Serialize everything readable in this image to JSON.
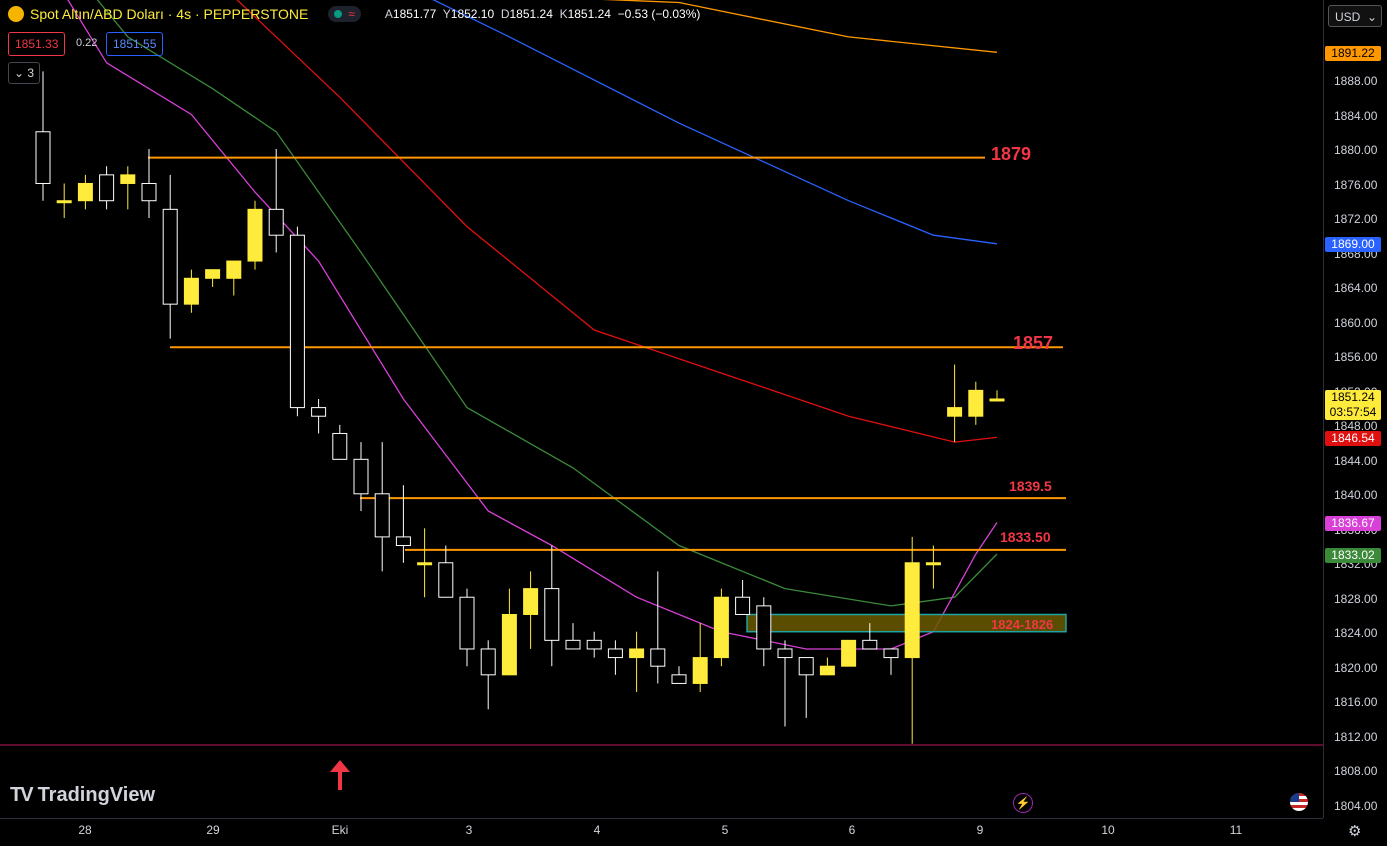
{
  "header": {
    "symbol_title": "Spot Altın/ABD Doları · 4s · PEPPERSTONE",
    "ohlc": {
      "a_label": "A",
      "a": "1851.77",
      "y_label": "Y",
      "y": "1852.10",
      "d_label": "D",
      "d": "1851.24",
      "k_label": "K",
      "k": "1851.24",
      "change": "−0.53 (−0.03%)"
    },
    "bid": "1851.33",
    "spread": "0.22",
    "ask": "1851.55",
    "indicators_count": "3"
  },
  "currency_select": "USD",
  "price_axis": {
    "ticks": [
      "1888.00",
      "1884.00",
      "1880.00",
      "1876.00",
      "1872.00",
      "1868.00",
      "1864.00",
      "1860.00",
      "1856.00",
      "1852.00",
      "1848.00",
      "1844.00",
      "1840.00",
      "1836.00",
      "1832.00",
      "1828.00",
      "1824.00",
      "1820.00",
      "1816.00",
      "1812.00",
      "1808.00",
      "1804.00"
    ],
    "badges": {
      "orange_ma": "1891.22",
      "blue_ma": "1869.00",
      "last_price": "1851.24",
      "countdown": "03:57:54",
      "red_ma": "1846.54",
      "magenta_ma": "1836.67",
      "green_ma": "1833.02"
    }
  },
  "time_axis": {
    "labels": [
      "28",
      "29",
      "Eki",
      "3",
      "4",
      "5",
      "6",
      "9",
      "10",
      "11"
    ]
  },
  "levels": {
    "l1879": "1879",
    "l1857": "1857",
    "l1839": "1839.5",
    "l1833": "1833.50",
    "zone": "1824-1826"
  },
  "brand": "TradingView",
  "colors": {
    "bull": "#ffeb3b",
    "bear": "#ffffff",
    "orange": "#ff9800",
    "red_ma": "#e01010",
    "blue_ma": "#2962ff",
    "magenta": "#d840d8",
    "green": "#3a8a3a",
    "level_text": "#f23645",
    "zone_fill": "#6b5a00",
    "zone_border": "#1fa3a3"
  },
  "chart_data": {
    "type": "candlestick",
    "y_range": [
      1802,
      1893
    ],
    "candles": [
      {
        "o": 1882,
        "h": 1889,
        "l": 1874,
        "c": 1876
      },
      {
        "o": 1874,
        "h": 1876,
        "l": 1872,
        "c": 1874
      },
      {
        "o": 1874,
        "h": 1877,
        "l": 1873,
        "c": 1876
      },
      {
        "o": 1877,
        "h": 1878,
        "l": 1873,
        "c": 1874
      },
      {
        "o": 1876,
        "h": 1878,
        "l": 1873,
        "c": 1877
      },
      {
        "o": 1876,
        "h": 1880,
        "l": 1872,
        "c": 1874
      },
      {
        "o": 1873,
        "h": 1877,
        "l": 1858,
        "c": 1862
      },
      {
        "o": 1862,
        "h": 1866,
        "l": 1861,
        "c": 1865
      },
      {
        "o": 1865,
        "h": 1866,
        "l": 1864,
        "c": 1866
      },
      {
        "o": 1865,
        "h": 1867,
        "l": 1863,
        "c": 1867
      },
      {
        "o": 1867,
        "h": 1874,
        "l": 1866,
        "c": 1873
      },
      {
        "o": 1873,
        "h": 1880,
        "l": 1868,
        "c": 1870
      },
      {
        "o": 1870,
        "h": 1871,
        "l": 1849,
        "c": 1850
      },
      {
        "o": 1850,
        "h": 1851,
        "l": 1847,
        "c": 1849
      },
      {
        "o": 1847,
        "h": 1848,
        "l": 1844,
        "c": 1844
      },
      {
        "o": 1844,
        "h": 1846,
        "l": 1838,
        "c": 1840
      },
      {
        "o": 1840,
        "h": 1846,
        "l": 1831,
        "c": 1835
      },
      {
        "o": 1835,
        "h": 1841,
        "l": 1832,
        "c": 1834
      },
      {
        "o": 1832,
        "h": 1836,
        "l": 1828,
        "c": 1832
      },
      {
        "o": 1832,
        "h": 1834,
        "l": 1828,
        "c": 1828
      },
      {
        "o": 1828,
        "h": 1829,
        "l": 1820,
        "c": 1822
      },
      {
        "o": 1822,
        "h": 1823,
        "l": 1815,
        "c": 1819
      },
      {
        "o": 1819,
        "h": 1829,
        "l": 1819,
        "c": 1826
      },
      {
        "o": 1826,
        "h": 1831,
        "l": 1822,
        "c": 1829
      },
      {
        "o": 1829,
        "h": 1834,
        "l": 1820,
        "c": 1823
      },
      {
        "o": 1823,
        "h": 1825,
        "l": 1822,
        "c": 1822
      },
      {
        "o": 1823,
        "h": 1824,
        "l": 1821,
        "c": 1822
      },
      {
        "o": 1822,
        "h": 1823,
        "l": 1819,
        "c": 1821
      },
      {
        "o": 1821,
        "h": 1824,
        "l": 1817,
        "c": 1822
      },
      {
        "o": 1822,
        "h": 1831,
        "l": 1818,
        "c": 1820
      },
      {
        "o": 1819,
        "h": 1820,
        "l": 1818,
        "c": 1818
      },
      {
        "o": 1818,
        "h": 1825,
        "l": 1817,
        "c": 1821
      },
      {
        "o": 1821,
        "h": 1829,
        "l": 1820,
        "c": 1828
      },
      {
        "o": 1828,
        "h": 1830,
        "l": 1826,
        "c": 1826
      },
      {
        "o": 1827,
        "h": 1828,
        "l": 1820,
        "c": 1822
      },
      {
        "o": 1822,
        "h": 1823,
        "l": 1813,
        "c": 1821
      },
      {
        "o": 1821,
        "h": 1821,
        "l": 1814,
        "c": 1819
      },
      {
        "o": 1819,
        "h": 1821,
        "l": 1819,
        "c": 1820
      },
      {
        "o": 1820,
        "h": 1823,
        "l": 1820,
        "c": 1823
      },
      {
        "o": 1823,
        "h": 1825,
        "l": 1822,
        "c": 1822
      },
      {
        "o": 1822,
        "h": 1822,
        "l": 1819,
        "c": 1821
      },
      {
        "o": 1821,
        "h": 1835,
        "l": 1811,
        "c": 1832
      },
      {
        "o": 1832,
        "h": 1834,
        "l": 1829,
        "c": 1832
      },
      {
        "o": 1849,
        "h": 1855,
        "l": 1846,
        "c": 1850
      },
      {
        "o": 1849,
        "h": 1853,
        "l": 1848,
        "c": 1852
      },
      {
        "o": 1851,
        "h": 1852,
        "l": 1851,
        "c": 1851
      }
    ],
    "moving_averages": [
      {
        "name": "orange",
        "color": "#ff9800",
        "points": [
          [
            0,
            1899
          ],
          [
            20,
            1898
          ],
          [
            30,
            1897
          ],
          [
            38,
            1893
          ],
          [
            45,
            1891.22
          ]
        ]
      },
      {
        "name": "blue",
        "color": "#2962ff",
        "points": [
          [
            0,
            1913
          ],
          [
            12,
            1905
          ],
          [
            22,
            1893
          ],
          [
            30,
            1883
          ],
          [
            38,
            1874
          ],
          [
            42,
            1870
          ],
          [
            45,
            1869.0
          ]
        ]
      },
      {
        "name": "red",
        "color": "#e01010",
        "points": [
          [
            0,
            1912
          ],
          [
            8,
            1900
          ],
          [
            14,
            1886
          ],
          [
            20,
            1871
          ],
          [
            26,
            1859
          ],
          [
            32,
            1854
          ],
          [
            38,
            1849
          ],
          [
            43,
            1846
          ],
          [
            45,
            1846.54
          ]
        ]
      },
      {
        "name": "green",
        "color": "#3a8a3a",
        "points": [
          [
            0,
            1905
          ],
          [
            4,
            1893
          ],
          [
            8,
            1887
          ],
          [
            11,
            1882
          ],
          [
            15,
            1868
          ],
          [
            20,
            1850
          ],
          [
            25,
            1843
          ],
          [
            30,
            1834
          ],
          [
            35,
            1829
          ],
          [
            40,
            1827
          ],
          [
            43,
            1828
          ],
          [
            45,
            1833.02
          ]
        ]
      },
      {
        "name": "magenta",
        "color": "#d840d8",
        "points": [
          [
            0,
            1902
          ],
          [
            3,
            1890
          ],
          [
            7,
            1884
          ],
          [
            10,
            1875
          ],
          [
            13,
            1867
          ],
          [
            17,
            1851
          ],
          [
            21,
            1838
          ],
          [
            24,
            1834
          ],
          [
            28,
            1828
          ],
          [
            32,
            1824
          ],
          [
            36,
            1822
          ],
          [
            40,
            1822
          ],
          [
            42,
            1824
          ],
          [
            44,
            1833
          ],
          [
            45,
            1836.67
          ]
        ]
      }
    ],
    "horizontal_levels": [
      1879,
      1857,
      1839.5,
      1833.5
    ],
    "zone": [
      1824,
      1826
    ]
  }
}
